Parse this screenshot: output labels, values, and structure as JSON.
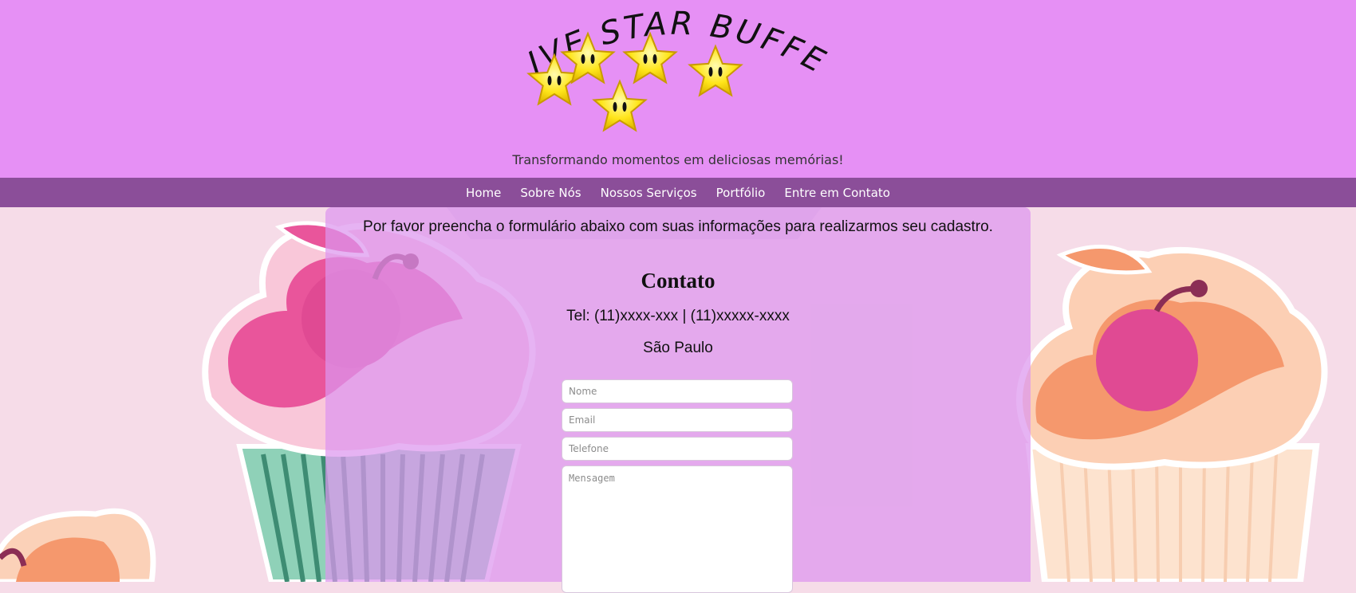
{
  "header": {
    "logo_text": "FIVE STAR BUFFET",
    "tagline": "Transformando momentos em deliciosas memórias!"
  },
  "nav": {
    "items": [
      "Home",
      "Sobre Nós",
      "Nossos Serviços",
      "Portfólio",
      "Entre em Contato"
    ]
  },
  "contact": {
    "intro": "Por favor preencha o formulário abaixo com suas informações para realizarmos seu cadastro.",
    "title": "Contato",
    "phone": "Tel: (11)xxxx-xxx | (11)xxxxx-xxxx",
    "city": "São Paulo"
  },
  "form": {
    "name_placeholder": "Nome",
    "email_placeholder": "Email",
    "phone_placeholder": "Telefone",
    "message_placeholder": "Mensagem"
  },
  "colors": {
    "header_bg": "#e690f5",
    "nav_bg": "#8b4e99",
    "page_bg": "#f6dce8",
    "panel_bg": "#dc96ee",
    "star": "#ffe51a"
  }
}
